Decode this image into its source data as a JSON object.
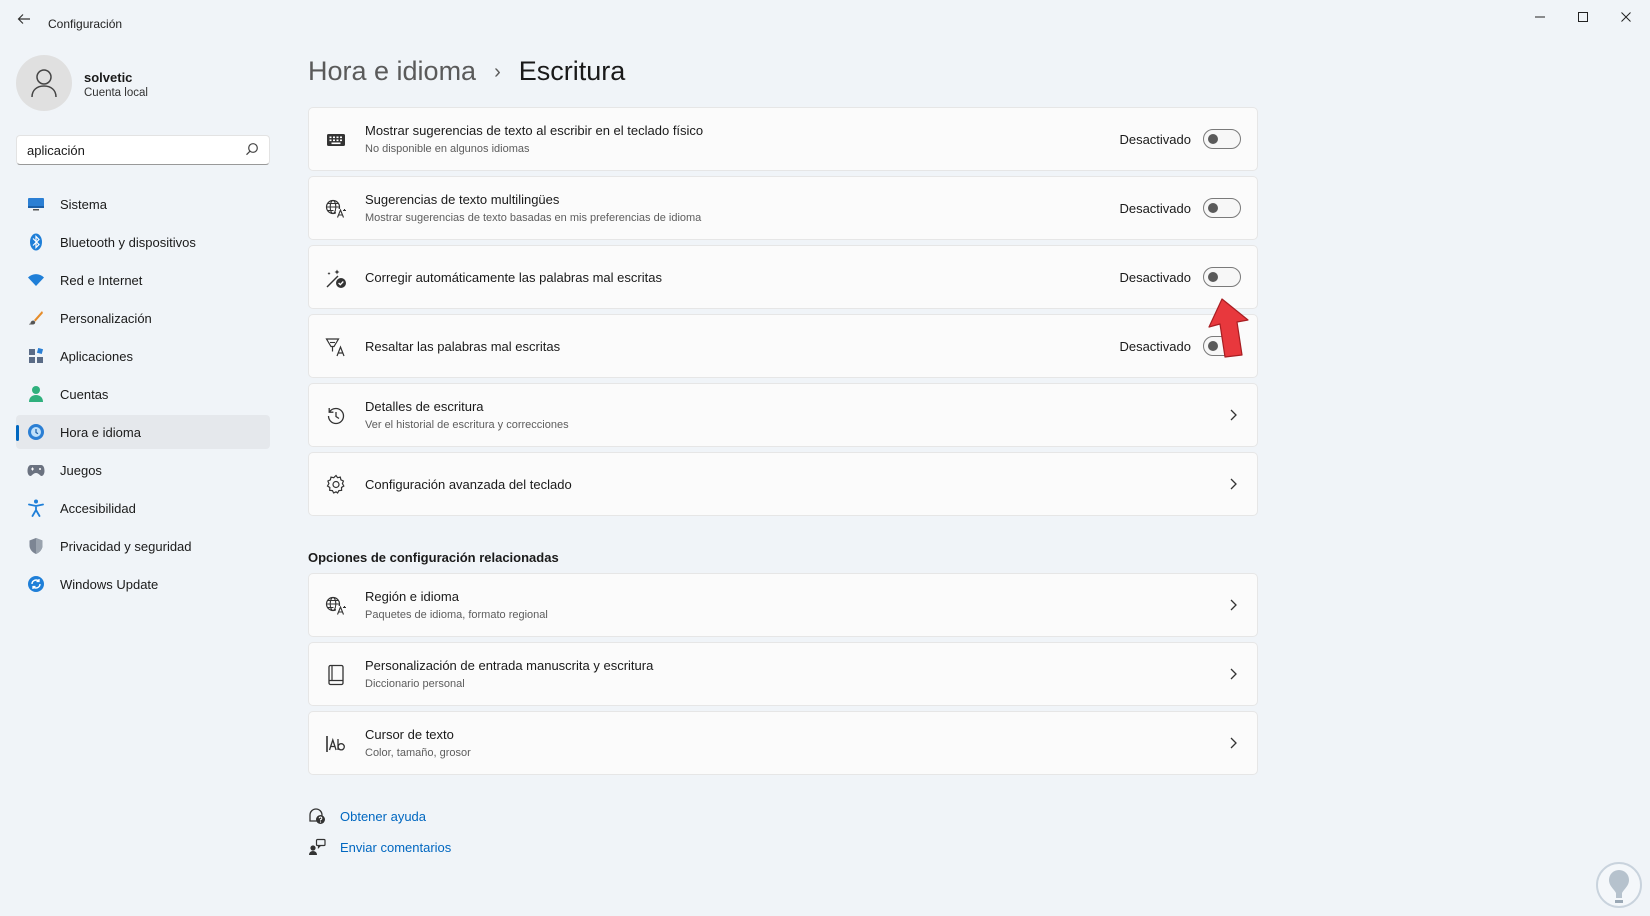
{
  "window": {
    "title": "Configuración",
    "controls": {
      "minimize": "—",
      "maximize": "☐",
      "close": "✕"
    }
  },
  "profile": {
    "name": "solvetic",
    "account": "Cuenta local"
  },
  "search": {
    "value": "aplicación"
  },
  "sidebar": {
    "items": [
      {
        "label": "Sistema",
        "icon": "system-icon"
      },
      {
        "label": "Bluetooth y dispositivos",
        "icon": "bluetooth-icon"
      },
      {
        "label": "Red e Internet",
        "icon": "wifi-icon"
      },
      {
        "label": "Personalización",
        "icon": "brush-icon"
      },
      {
        "label": "Aplicaciones",
        "icon": "apps-icon"
      },
      {
        "label": "Cuentas",
        "icon": "person-icon"
      },
      {
        "label": "Hora e idioma",
        "icon": "time-language-icon",
        "active": true
      },
      {
        "label": "Juegos",
        "icon": "gamepad-icon"
      },
      {
        "label": "Accesibilidad",
        "icon": "accessibility-icon"
      },
      {
        "label": "Privacidad y seguridad",
        "icon": "shield-icon"
      },
      {
        "label": "Windows Update",
        "icon": "update-icon"
      }
    ]
  },
  "breadcrumb": {
    "parent": "Hora e idioma",
    "separator": "›",
    "current": "Escritura"
  },
  "settings": [
    {
      "title": "Mostrar sugerencias de texto al escribir en el teclado físico",
      "subtitle": "No disponible en algunos idiomas",
      "status": "Desactivado",
      "type": "toggle",
      "icon": "keyboard-icon"
    },
    {
      "title": "Sugerencias de texto multilingües",
      "subtitle": "Mostrar sugerencias de texto basadas en mis preferencias de idioma",
      "status": "Desactivado",
      "type": "toggle",
      "icon": "language-icon"
    },
    {
      "title": "Corregir automáticamente las palabras mal escritas",
      "subtitle": "",
      "status": "Desactivado",
      "type": "toggle",
      "icon": "autocorrect-icon"
    },
    {
      "title": "Resaltar las palabras mal escritas",
      "subtitle": "",
      "status": "Desactivado",
      "type": "toggle",
      "icon": "highlight-spelling-icon"
    },
    {
      "title": "Detalles de escritura",
      "subtitle": "Ver el historial de escritura y correcciones",
      "type": "link",
      "icon": "history-icon"
    },
    {
      "title": "Configuración avanzada del teclado",
      "subtitle": "",
      "type": "link",
      "icon": "gear-icon"
    }
  ],
  "related": {
    "heading": "Opciones de configuración relacionadas",
    "items": [
      {
        "title": "Región e idioma",
        "subtitle": "Paquetes de idioma, formato regional",
        "icon": "language-icon"
      },
      {
        "title": "Personalización de entrada manuscrita y escritura",
        "subtitle": "Diccionario personal",
        "icon": "notebook-icon"
      },
      {
        "title": "Cursor de texto",
        "subtitle": "Color, tamaño, grosor",
        "icon": "text-cursor-icon"
      }
    ]
  },
  "help": {
    "get_help": "Obtener ayuda",
    "feedback": "Enviar comentarios"
  },
  "colors": {
    "accent": "#0067c0",
    "arrow": "#e8383d"
  }
}
